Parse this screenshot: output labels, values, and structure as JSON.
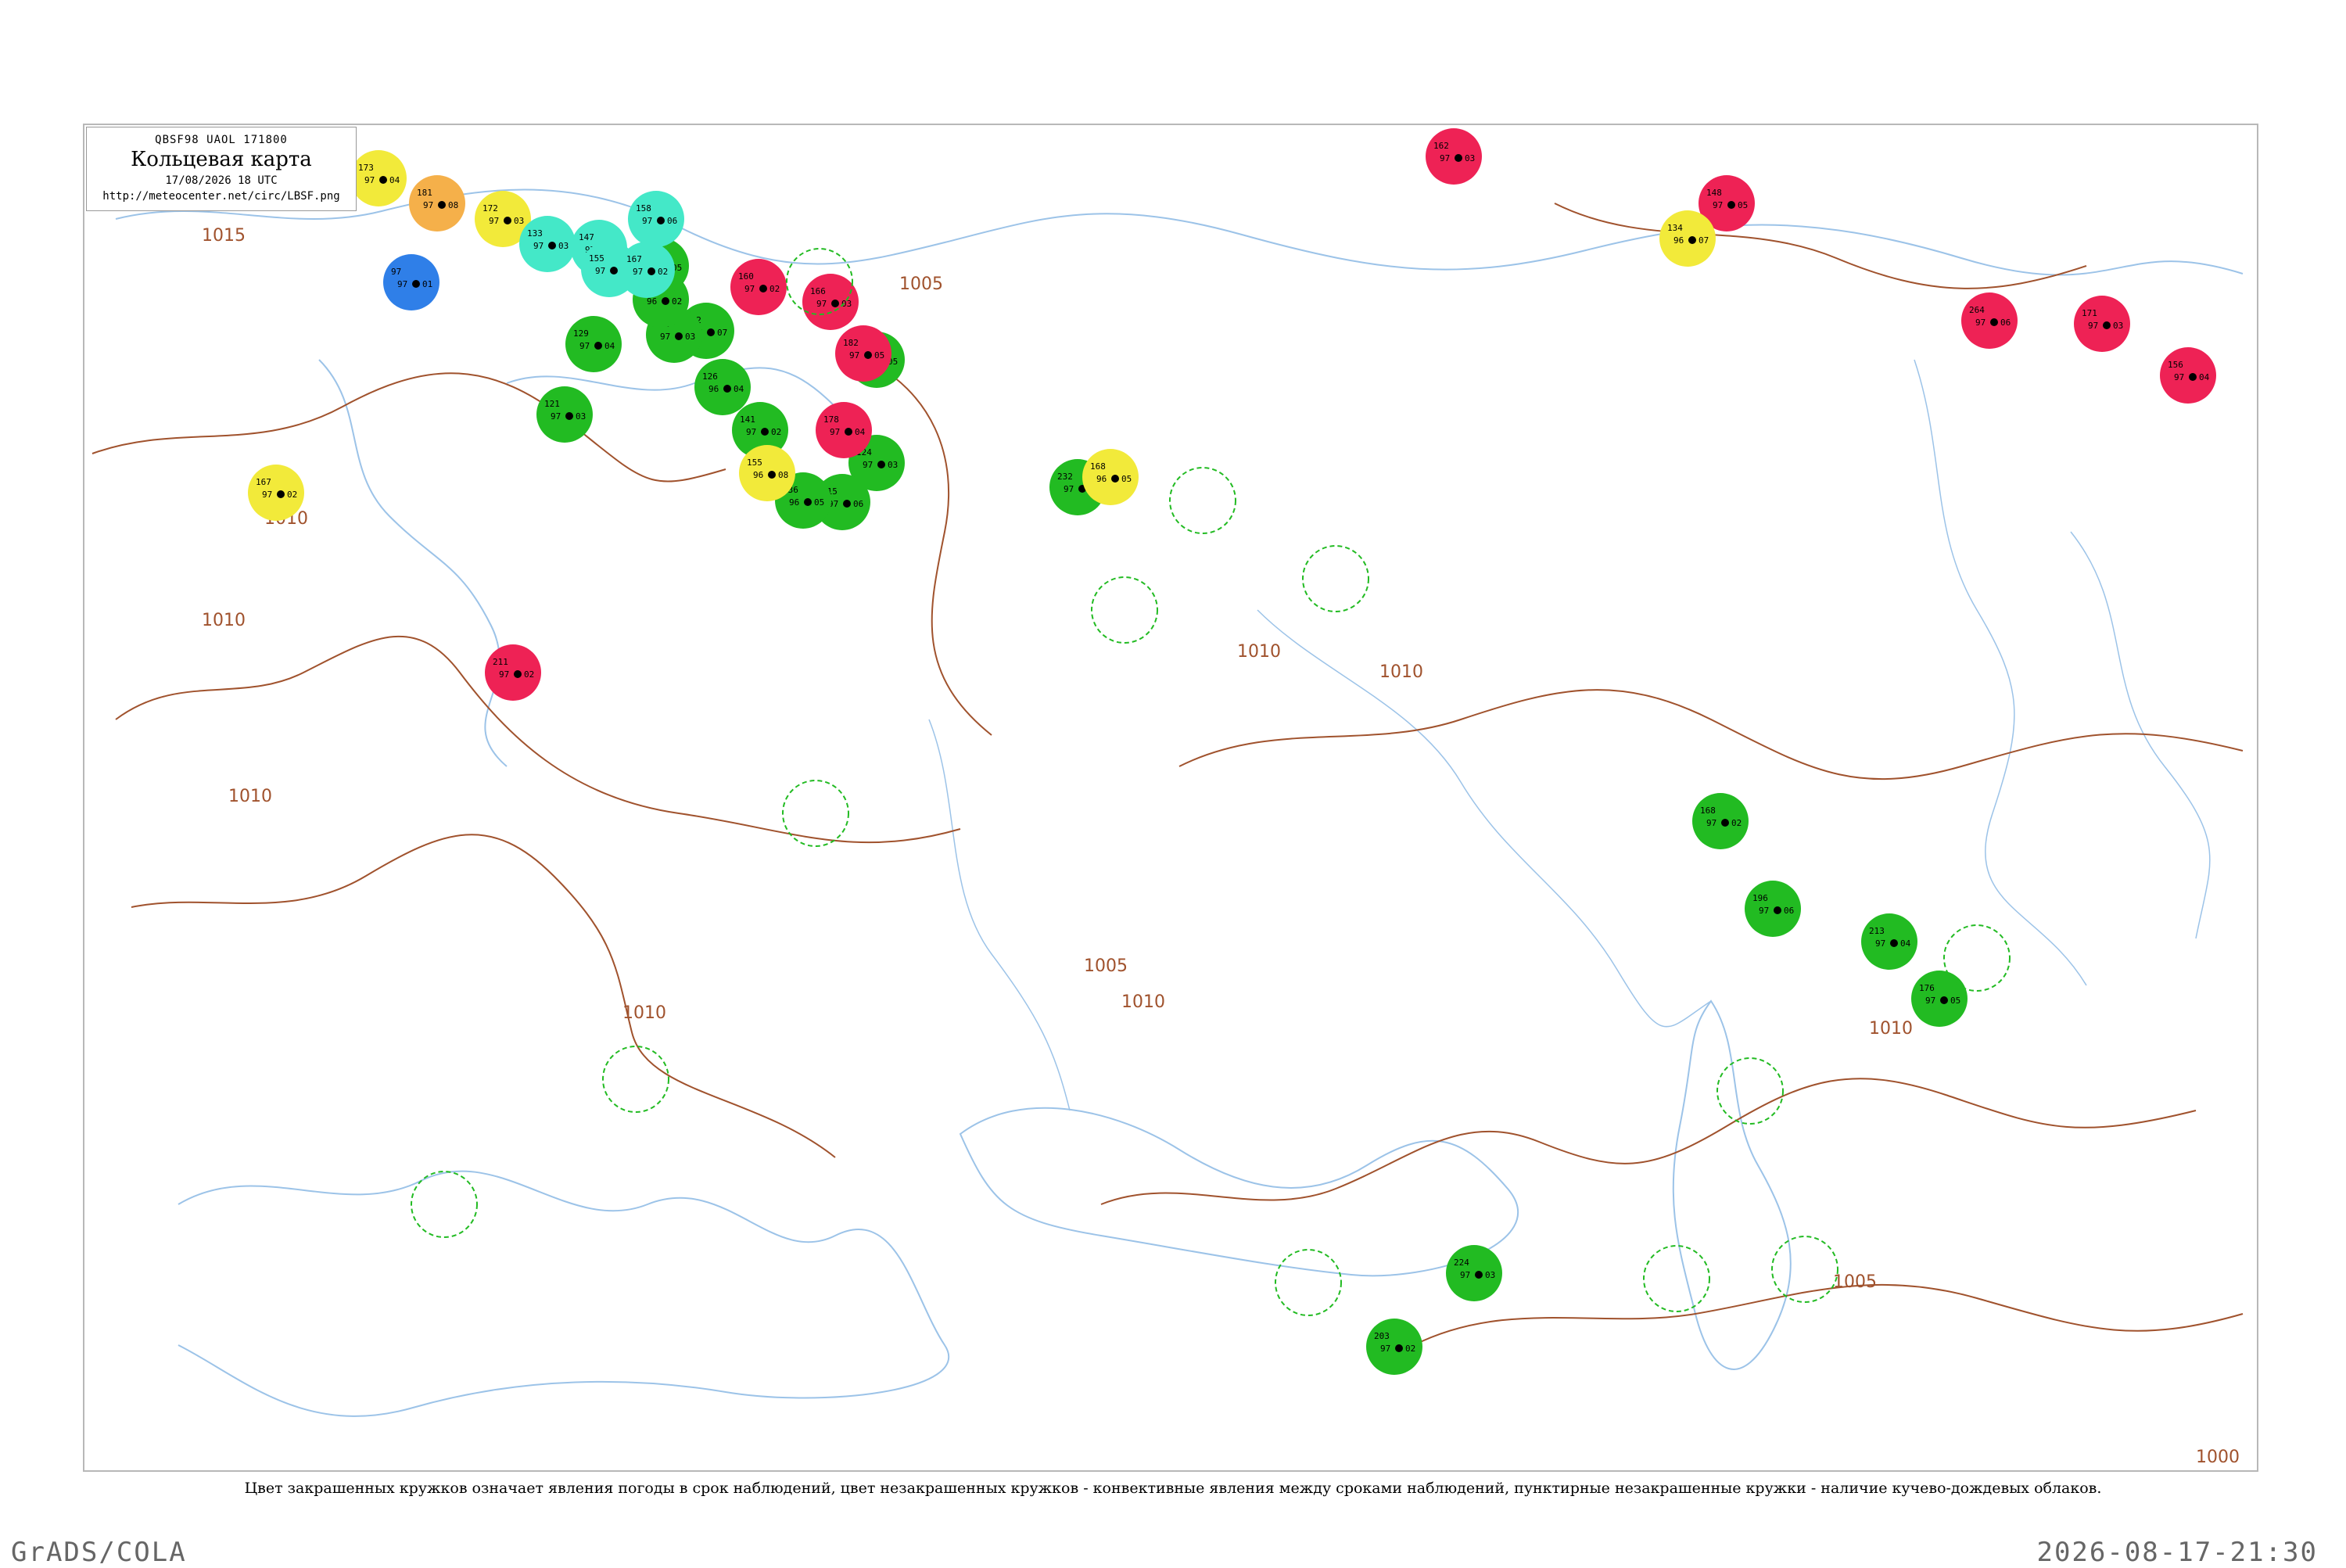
{
  "header": {
    "code": "QBSF98  UAOL  171800",
    "title": "Кольцевая карта",
    "datetime": "17/08/2026 18 UTC",
    "url": "http://meteocenter.net/circ/LBSF.png"
  },
  "legend_note": "Цвет закрашенных кружков означает явления погоды в срок наблюдений, цвет незакрашенных кружков - конвективные явления между сроками наблюдений, пунктирные незакрашенные кружки - наличие кучево-дождевых облаков.",
  "footer": {
    "left": "GrADS/COLA",
    "right": "2026-08-17-21:30"
  },
  "colors": {
    "coastline": "#9cc3e8",
    "isobar": "#a0522d",
    "rain": "#22bb22",
    "thunder": "#ee2255",
    "fog": "#f2ea3a",
    "haze": "#f5b04a",
    "shower": "#44e8c8",
    "snow": "#2f7fe8"
  },
  "isobars": [
    "1015",
    "1010",
    "1010",
    "1010",
    "1005",
    "1005",
    "1010",
    "1010",
    "1010",
    "1010",
    "1005",
    "1010",
    "1000"
  ],
  "stations": [
    {
      "wx": "rain",
      "t": "118",
      "p": "97",
      "d": "05"
    },
    {
      "wx": "rain",
      "t": "124",
      "p": "97",
      "d": "03"
    },
    {
      "wx": "rain",
      "t": "115",
      "p": "97",
      "d": "06"
    },
    {
      "wx": "rain",
      "t": "136",
      "p": "96",
      "d": "05"
    },
    {
      "wx": "rain",
      "t": "141",
      "p": "97",
      "d": "02"
    },
    {
      "wx": "rain",
      "t": "126",
      "p": "96",
      "d": "04"
    },
    {
      "wx": "rain",
      "t": "122",
      "p": "97",
      "d": "07"
    },
    {
      "wx": "rain",
      "t": "131",
      "p": "97",
      "d": "03"
    },
    {
      "wx": "rain",
      "t": "144",
      "p": "96",
      "d": "02"
    },
    {
      "wx": "rain",
      "t": "114",
      "p": "97",
      "d": "05"
    },
    {
      "wx": "rain",
      "t": "129",
      "p": "97",
      "d": "04"
    },
    {
      "wx": "rain",
      "t": "121",
      "p": "97",
      "d": "03"
    },
    {
      "wx": "rain",
      "t": "168",
      "p": "97",
      "d": "02"
    },
    {
      "wx": "rain",
      "t": "196",
      "p": "97",
      "d": "06"
    },
    {
      "wx": "rain",
      "t": "213",
      "p": "97",
      "d": "04"
    },
    {
      "wx": "rain",
      "t": "176",
      "p": "97",
      "d": "05"
    },
    {
      "wx": "rain",
      "t": "224",
      "p": "97",
      "d": "03"
    },
    {
      "wx": "rain",
      "t": "203",
      "p": "97",
      "d": "02"
    },
    {
      "wx": "rain",
      "t": "232",
      "p": "97",
      "d": "04"
    },
    {
      "wx": "thunder",
      "t": "160",
      "p": "97",
      "d": "02"
    },
    {
      "wx": "thunder",
      "t": "178",
      "p": "97",
      "d": "04"
    },
    {
      "wx": "thunder",
      "t": "182",
      "p": "97",
      "d": "05"
    },
    {
      "wx": "thunder",
      "t": "166",
      "p": "97",
      "d": "03"
    },
    {
      "wx": "thunder",
      "t": "211",
      "p": "97",
      "d": "02"
    },
    {
      "wx": "thunder",
      "t": "264",
      "p": "97",
      "d": "06"
    },
    {
      "wx": "thunder",
      "t": "171",
      "p": "97",
      "d": "03"
    },
    {
      "wx": "thunder",
      "t": "156",
      "p": "97",
      "d": "04"
    },
    {
      "wx": "thunder",
      "t": "162",
      "p": "97",
      "d": "03"
    },
    {
      "wx": "thunder",
      "t": "148",
      "p": "97",
      "d": "05"
    },
    {
      "wx": "fog",
      "t": "134",
      "p": "96",
      "d": "07"
    },
    {
      "wx": "fog",
      "t": "155",
      "p": "96",
      "d": "08"
    },
    {
      "wx": "fog",
      "t": "168",
      "p": "96",
      "d": "05"
    },
    {
      "wx": "fog",
      "t": "167",
      "p": "97",
      "d": "02"
    },
    {
      "wx": "fog",
      "t": "172",
      "p": "97",
      "d": "03"
    },
    {
      "wx": "fog",
      "t": "173",
      "p": "97",
      "d": "04"
    },
    {
      "wx": "haze",
      "t": "181",
      "p": "97",
      "d": "08"
    },
    {
      "wx": "shower",
      "t": "147",
      "p": "97",
      "d": "05"
    },
    {
      "wx": "shower",
      "t": "133",
      "p": "97",
      "d": "03"
    },
    {
      "wx": "shower",
      "t": "155",
      "p": "97",
      "d": "04"
    },
    {
      "wx": "shower",
      "t": "167",
      "p": "97",
      "d": "02"
    },
    {
      "wx": "shower",
      "t": "158",
      "p": "97",
      "d": "06"
    },
    {
      "wx": "snow",
      "t": "97",
      "p": "97",
      "d": "01"
    }
  ]
}
